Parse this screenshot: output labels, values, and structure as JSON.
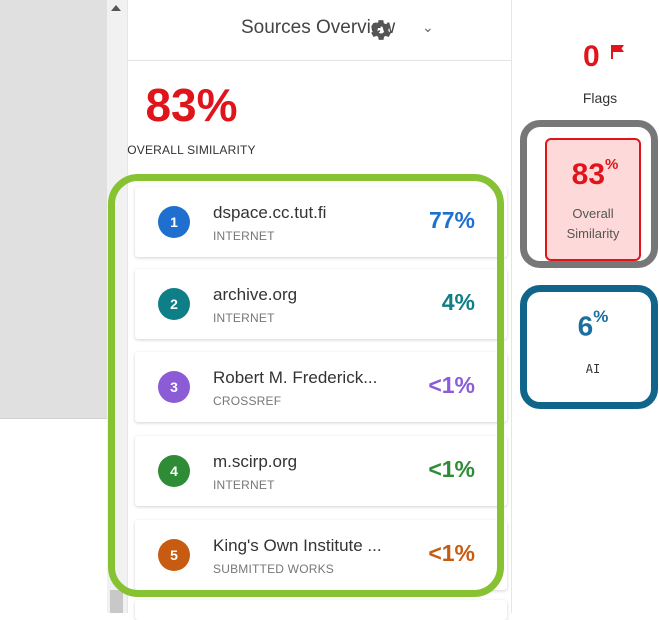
{
  "header": {
    "title": "Sources Overview",
    "chevron": "chevron-down-icon"
  },
  "overall": {
    "percent": "83%",
    "label": "OVERALL SIMILARITY"
  },
  "sources": [
    {
      "number": "1",
      "name": "dspace.cc.tut.fi",
      "type": "INTERNET",
      "percent": "77%",
      "color": "#1e6fd0"
    },
    {
      "number": "2",
      "name": "archive.org",
      "type": "INTERNET",
      "percent": "4%",
      "color": "#0e7f86"
    },
    {
      "number": "3",
      "name": "Robert M. Frederick...",
      "type": "CROSSREF",
      "percent": "<1%",
      "color": "#8b5cd6"
    },
    {
      "number": "4",
      "name": "m.scirp.org",
      "type": "INTERNET",
      "percent": "<1%",
      "color": "#2e8b36"
    },
    {
      "number": "5",
      "name": "King's Own Institute ...",
      "type": "SUBMITTED WORKS",
      "percent": "<1%",
      "color": "#c85b12"
    }
  ],
  "rail": {
    "flags_value": "0",
    "flags_label": "Flags",
    "similarity_value": "83",
    "similarity_unit": "%",
    "similarity_label_line1": "Overall",
    "similarity_label_line2": "Similarity",
    "ai_value": "6",
    "ai_unit": "%",
    "ai_label": "AI"
  },
  "colors": {
    "accent_red": "#e0151c",
    "highlight_green": "#86c232",
    "highlight_gray": "#777777",
    "highlight_blue": "#11658a"
  }
}
